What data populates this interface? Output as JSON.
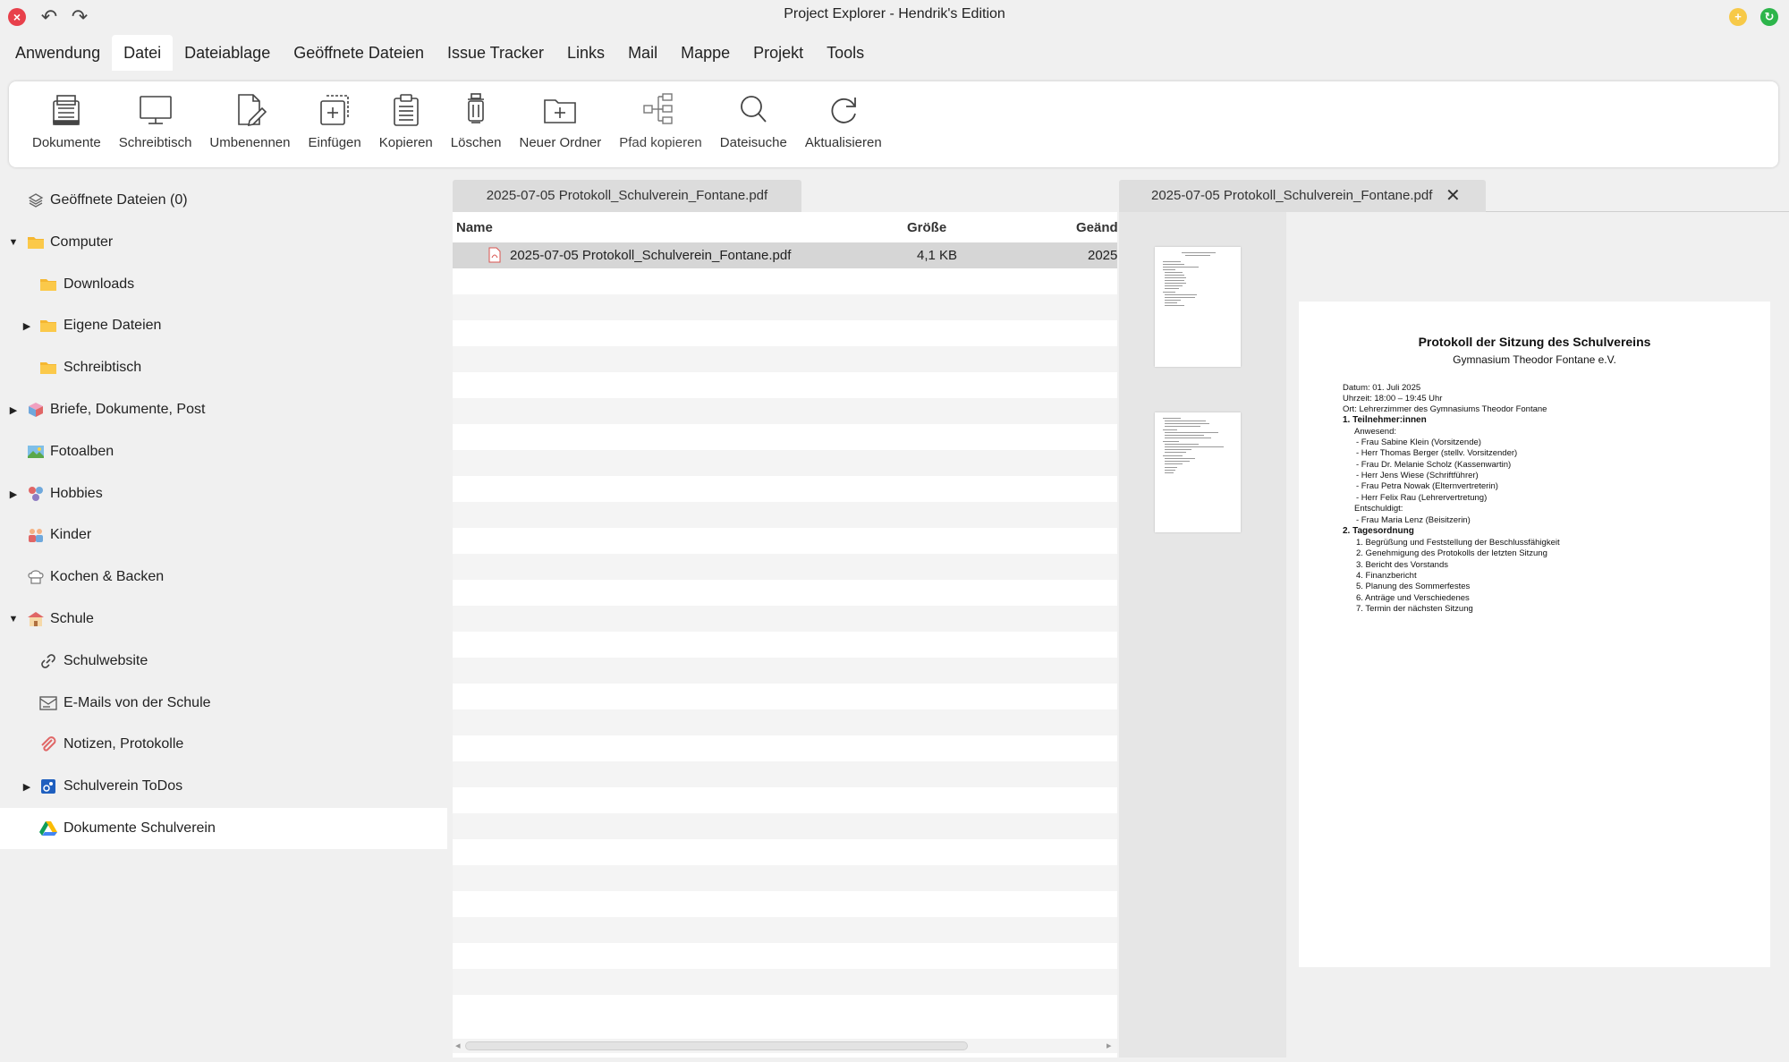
{
  "window": {
    "title": "Project Explorer - Hendrik's Edition"
  },
  "menu": [
    {
      "label": "Anwendung",
      "active": false
    },
    {
      "label": "Datei",
      "active": true
    },
    {
      "label": "Dateiablage",
      "active": false
    },
    {
      "label": "Geöffnete Dateien",
      "active": false
    },
    {
      "label": "Issue Tracker",
      "active": false
    },
    {
      "label": "Links",
      "active": false
    },
    {
      "label": "Mail",
      "active": false
    },
    {
      "label": "Mappe",
      "active": false
    },
    {
      "label": "Projekt",
      "active": false
    },
    {
      "label": "Tools",
      "active": false
    }
  ],
  "ribbon": [
    {
      "label": "Dokumente",
      "icon": "documents-icon"
    },
    {
      "label": "Schreibtisch",
      "icon": "monitor-icon"
    },
    {
      "label": "Umbenennen",
      "icon": "rename-icon"
    },
    {
      "label": "Einfügen",
      "icon": "paste-icon"
    },
    {
      "label": "Kopieren",
      "icon": "copy-icon"
    },
    {
      "label": "Löschen",
      "icon": "trash-icon"
    },
    {
      "label": "Neuer Ordner",
      "icon": "new-folder-icon"
    },
    {
      "label": "Pfad kopieren",
      "icon": "copy-path-icon"
    },
    {
      "label": "Dateisuche",
      "icon": "search-icon"
    },
    {
      "label": "Aktualisieren",
      "icon": "refresh-icon"
    }
  ],
  "sidebar": {
    "items": [
      {
        "label": "Geöffnete Dateien (0)",
        "icon": "stack-icon",
        "expander": ""
      },
      {
        "label": "Computer",
        "icon": "folder-icon",
        "expander": "expanded"
      },
      {
        "label": "Downloads",
        "icon": "folder-icon",
        "expander": ""
      },
      {
        "label": "Eigene Dateien",
        "icon": "folder-icon",
        "expander": "collapsed"
      },
      {
        "label": "Schreibtisch",
        "icon": "folder-icon",
        "expander": ""
      },
      {
        "label": "Briefe, Dokumente, Post",
        "icon": "cube-icon",
        "expander": "collapsed"
      },
      {
        "label": "Fotoalben",
        "icon": "photo-icon",
        "expander": ""
      },
      {
        "label": "Hobbies",
        "icon": "hobbies-icon",
        "expander": "collapsed"
      },
      {
        "label": "Kinder",
        "icon": "kids-icon",
        "expander": ""
      },
      {
        "label": "Kochen & Backen",
        "icon": "chef-hat-icon",
        "expander": ""
      },
      {
        "label": "Schule",
        "icon": "school-icon",
        "expander": "expanded"
      },
      {
        "label": "Schulwebsite",
        "icon": "link-icon",
        "expander": ""
      },
      {
        "label": "E-Mails von der Schule",
        "icon": "mail-icon",
        "expander": ""
      },
      {
        "label": "Notizen, Protokolle",
        "icon": "paperclip-icon",
        "expander": ""
      },
      {
        "label": "Schulverein ToDos",
        "icon": "todo-icon",
        "expander": "collapsed"
      },
      {
        "label": "Dokumente Schulverein",
        "icon": "google-drive-icon",
        "expander": "",
        "selected": true
      }
    ]
  },
  "left_pane": {
    "tab_label": "2025-07-05 Protokoll_Schulverein_Fontane.pdf",
    "columns": {
      "name": "Name",
      "size": "Größe",
      "modified": "Geänd"
    },
    "rows": [
      {
        "name": "2025-07-05 Protokoll_Schulverein_Fontane.pdf",
        "size": "4,1 KB",
        "modified": "2025"
      }
    ]
  },
  "right_pane": {
    "tab_label": "2025-07-05 Protokoll_Schulverein_Fontane.pdf",
    "document": {
      "title": "Protokoll der Sitzung des Schulvereins",
      "subtitle": "Gymnasium Theodor Fontane e.V.",
      "meta": [
        "Datum: 01. Juli 2025",
        "Uhrzeit: 18:00 – 19:45 Uhr",
        "Ort: Lehrerzimmer des Gymnasiums Theodor Fontane"
      ],
      "section1_title": "1. Teilnehmer:innen",
      "present_label": "Anwesend:",
      "present": [
        "- Frau Sabine Klein (Vorsitzende)",
        "- Herr Thomas Berger (stellv. Vorsitzender)",
        "- Frau Dr. Melanie Scholz (Kassenwartin)",
        "- Herr Jens Wiese (Schriftführer)",
        "- Frau Petra Nowak (Elternvertreterin)",
        "- Herr Felix Rau (Lehrervertretung)"
      ],
      "excused_label": "Entschuldigt:",
      "excused": [
        "- Frau Maria Lenz (Beisitzerin)"
      ],
      "section2_title": "2. Tagesordnung",
      "agenda": [
        "1. Begrüßung und Feststellung der Beschlussfähigkeit",
        "2. Genehmigung des Protokolls der letzten Sitzung",
        "3. Bericht des Vorstands",
        "4. Finanzbericht",
        "5. Planung des Sommerfestes",
        "6. Anträge und Verschiedenes",
        "7. Termin der nächsten Sitzung"
      ]
    }
  }
}
